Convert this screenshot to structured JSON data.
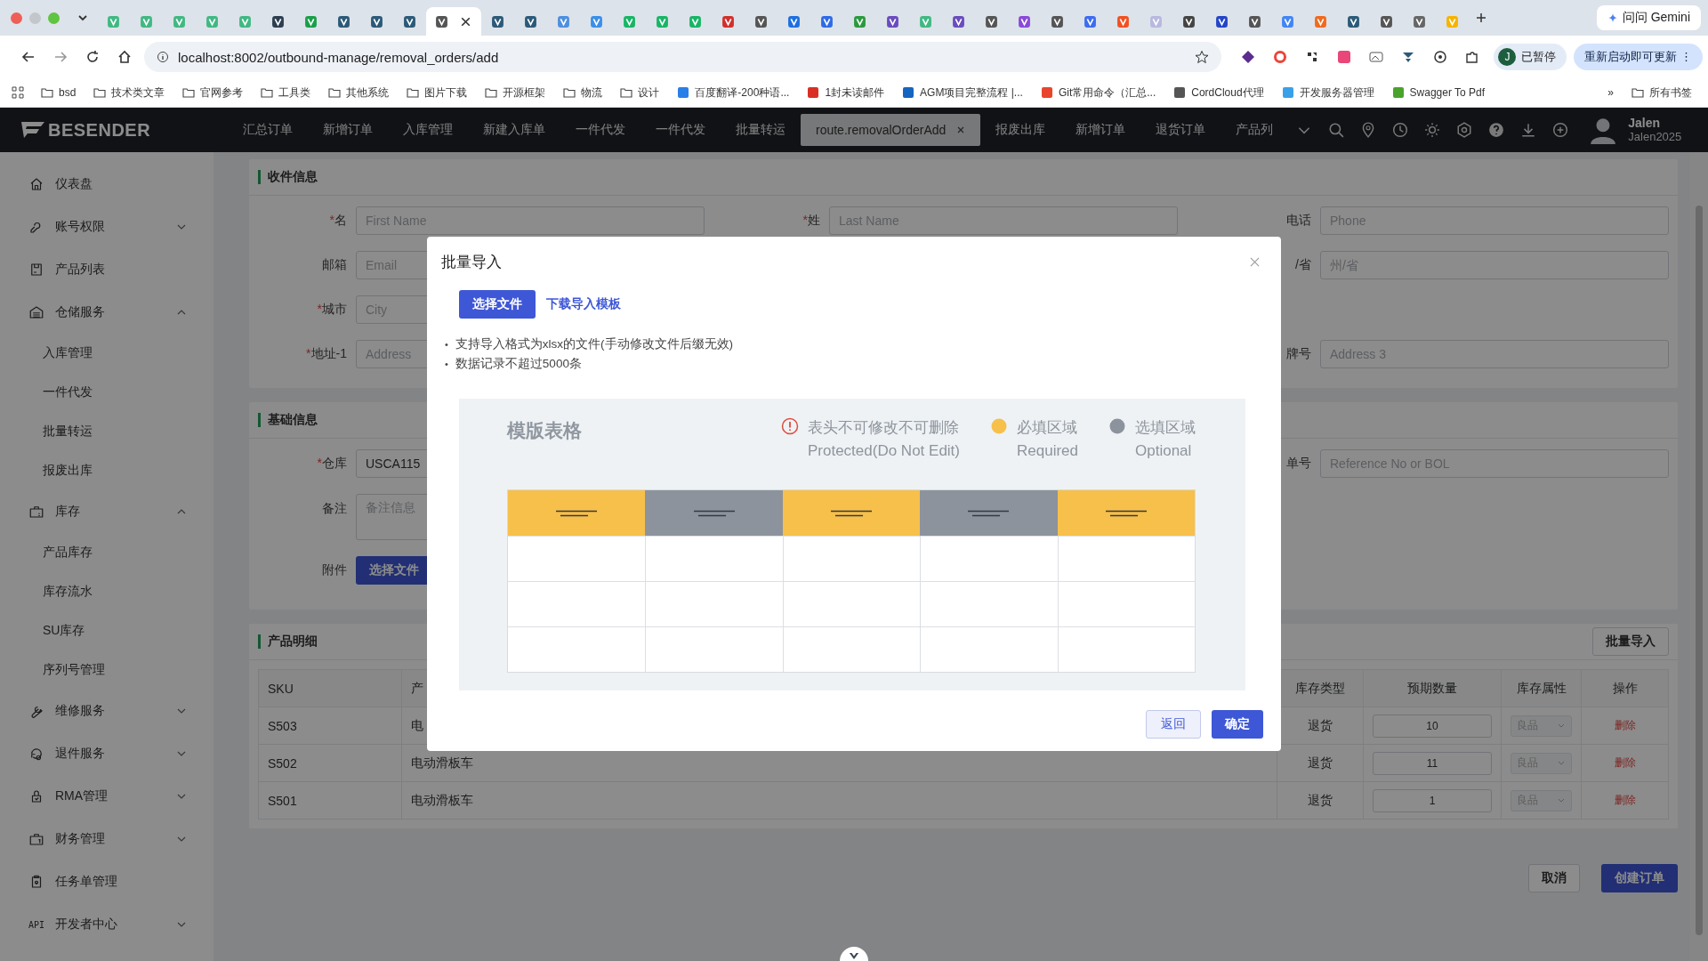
{
  "browser": {
    "tabs": [
      {
        "selected": false,
        "color": "#41b883"
      },
      {
        "selected": false,
        "color": "#41b883"
      },
      {
        "selected": false,
        "color": "#41b883"
      },
      {
        "selected": false,
        "color": "#41b883"
      },
      {
        "selected": false,
        "color": "#41b883"
      },
      {
        "selected": false,
        "color": "#2c3e50"
      },
      {
        "selected": false,
        "color": "#1a9f4a"
      },
      {
        "selected": false,
        "color": "#2c5a78"
      },
      {
        "selected": false,
        "color": "#2c5a78"
      },
      {
        "selected": false,
        "color": "#2c5a78"
      },
      {
        "selected": true,
        "color": "#555555"
      },
      {
        "selected": false,
        "color": "#2c5a78"
      },
      {
        "selected": false,
        "color": "#2c5a78"
      },
      {
        "selected": false,
        "color": "#4d8fe0"
      },
      {
        "selected": false,
        "color": "#3b8fe8"
      },
      {
        "selected": false,
        "color": "#18b566"
      },
      {
        "selected": false,
        "color": "#18b566"
      },
      {
        "selected": false,
        "color": "#18b566"
      },
      {
        "selected": false,
        "color": "#d0312d"
      },
      {
        "selected": false,
        "color": "#555555"
      },
      {
        "selected": false,
        "color": "#1d6fe0"
      },
      {
        "selected": false,
        "color": "#2f6be6"
      },
      {
        "selected": false,
        "color": "#2b9a3e"
      },
      {
        "selected": false,
        "color": "#6a4cbf"
      },
      {
        "selected": false,
        "color": "#41b883"
      },
      {
        "selected": false,
        "color": "#6a4cbf"
      },
      {
        "selected": false,
        "color": "#555555"
      },
      {
        "selected": false,
        "color": "#8a4ad8"
      },
      {
        "selected": false,
        "color": "#555555"
      },
      {
        "selected": false,
        "color": "#3d6cf0"
      },
      {
        "selected": false,
        "color": "#f25022"
      },
      {
        "selected": false,
        "color": "#b8b8e0"
      },
      {
        "selected": false,
        "color": "#444444"
      },
      {
        "selected": false,
        "color": "#2345c8"
      },
      {
        "selected": false,
        "color": "#555555"
      },
      {
        "selected": false,
        "color": "#4285f4"
      },
      {
        "selected": false,
        "color": "#f06a1d"
      },
      {
        "selected": false,
        "color": "#2c5a78"
      },
      {
        "selected": false,
        "color": "#555555"
      },
      {
        "selected": false,
        "color": "#666666"
      },
      {
        "selected": false,
        "color": "#f5b400"
      }
    ],
    "gemini": "问问 Gemini",
    "url": "localhost:8002/outbound-manage/removal_orders/add",
    "profile_initial": "J",
    "profile_status": "已暂停",
    "update_button": "重新启动即可更新",
    "update_menu": "⋮",
    "bookmarks": [
      {
        "kind": "folder",
        "label": "bsd"
      },
      {
        "kind": "folder",
        "label": "技术类文章"
      },
      {
        "kind": "folder",
        "label": "官网参考"
      },
      {
        "kind": "folder",
        "label": "工具类"
      },
      {
        "kind": "folder",
        "label": "其他系统"
      },
      {
        "kind": "folder",
        "label": "图片下载"
      },
      {
        "kind": "folder",
        "label": "开源框架"
      },
      {
        "kind": "folder",
        "label": "物流"
      },
      {
        "kind": "folder",
        "label": "设计"
      },
      {
        "kind": "site",
        "label": "百度翻译-200种语...",
        "color": "#2a7ee8"
      },
      {
        "kind": "site",
        "label": "1封未读邮件",
        "color": "#d93025"
      },
      {
        "kind": "site",
        "label": "AGM项目完整流程 |...",
        "color": "#1565c0"
      },
      {
        "kind": "site",
        "label": "Git常用命令（汇总...",
        "color": "#e8452c"
      },
      {
        "kind": "site",
        "label": "CordCloud代理",
        "color": "#555555"
      },
      {
        "kind": "site",
        "label": "开发服务器管理",
        "color": "#3aa0e8"
      },
      {
        "kind": "site",
        "label": "Swagger To Pdf",
        "color": "#49a32b"
      }
    ],
    "more": "»",
    "all_bookmarks": "所有书签"
  },
  "app": {
    "logo": "BESENDER",
    "nav": [
      {
        "label": "汇总订单",
        "selected": false
      },
      {
        "label": "新增订单",
        "selected": false
      },
      {
        "label": "入库管理",
        "selected": false
      },
      {
        "label": "新建入库单",
        "selected": false
      },
      {
        "label": "一件代发",
        "selected": false
      },
      {
        "label": "一件代发",
        "selected": false
      },
      {
        "label": "批量转运",
        "selected": false
      },
      {
        "label": "route.removalOrderAdd",
        "selected": true
      },
      {
        "label": "报废出库",
        "selected": false
      },
      {
        "label": "新增订单",
        "selected": false
      },
      {
        "label": "退货订单",
        "selected": false
      },
      {
        "label": "产品列",
        "selected": false
      }
    ],
    "user": {
      "name": "Jalen",
      "account": "Jalen2025"
    }
  },
  "sidebar": [
    {
      "kind": "link",
      "label": "仪表盘"
    },
    {
      "kind": "group",
      "label": "账号权限",
      "expanded": false
    },
    {
      "kind": "link",
      "label": "产品列表"
    },
    {
      "kind": "group",
      "label": "仓储服务",
      "expanded": true,
      "children": [
        {
          "label": "入库管理"
        },
        {
          "label": "一件代发"
        },
        {
          "label": "批量转运"
        },
        {
          "label": "报废出库"
        }
      ]
    },
    {
      "kind": "group",
      "label": "库存",
      "expanded": true,
      "children": [
        {
          "label": "产品库存"
        },
        {
          "label": "库存流水"
        },
        {
          "label": "SU库存"
        },
        {
          "label": "序列号管理"
        }
      ]
    },
    {
      "kind": "group",
      "label": "维修服务",
      "expanded": false
    },
    {
      "kind": "group",
      "label": "退件服务",
      "expanded": false
    },
    {
      "kind": "group",
      "label": "RMA管理",
      "expanded": false
    },
    {
      "kind": "group",
      "label": "财务管理",
      "expanded": false
    },
    {
      "kind": "link",
      "label": "任务单管理"
    },
    {
      "kind": "group",
      "label": "开发者中心",
      "expanded": false,
      "icon_text": "API"
    }
  ],
  "required_mark": "*",
  "recipient": {
    "title": "收件信息",
    "rows": [
      [
        {
          "label": "名",
          "required": true,
          "placeholder": "First Name"
        },
        {
          "label": "姓",
          "required": true,
          "placeholder": "Last Name"
        },
        {
          "label": "电话",
          "required": false,
          "placeholder": "Phone"
        }
      ],
      [
        {
          "label": "邮箱",
          "required": false,
          "placeholder": "Email"
        },
        null,
        {
          "label": "/省",
          "placeholder": "州/省"
        }
      ],
      [
        {
          "label": "城市",
          "required": true,
          "placeholder": "City"
        },
        null,
        null
      ],
      [
        {
          "label": "地址-1",
          "required": true,
          "placeholder": "Address"
        },
        null,
        {
          "label": "牌号",
          "placeholder": "Address 3"
        }
      ]
    ]
  },
  "basic": {
    "title": "基础信息",
    "warehouse": {
      "label": "仓库",
      "required": true,
      "value": "USCA115"
    },
    "reference": {
      "label": "单号",
      "placeholder": "Reference No or BOL"
    },
    "remark": {
      "label": "备注",
      "placeholder": "备注信息"
    },
    "attachment": {
      "label": "附件",
      "button": "选择文件"
    }
  },
  "products": {
    "title": "产品明细",
    "import_button": "批量导入",
    "columns": [
      "SKU",
      "产",
      "库存类型",
      "预期数量",
      "库存属性",
      "操作"
    ],
    "rows": [
      {
        "sku": "S503",
        "name": "电",
        "type": "退货",
        "qty": "10",
        "attr": "良品",
        "action": "删除"
      },
      {
        "sku": "S502",
        "name": "电动滑板车",
        "type": "退货",
        "qty": "11",
        "attr": "良品",
        "action": "删除"
      },
      {
        "sku": "S501",
        "name": "电动滑板车",
        "type": "退货",
        "qty": "1",
        "attr": "良品",
        "action": "删除"
      }
    ]
  },
  "footer": {
    "cancel": "取消",
    "submit": "创建订单"
  },
  "dialog": {
    "title": "批量导入",
    "choose_file": "选择文件",
    "download_template": "下载导入模板",
    "note_marker": "•",
    "notes": [
      "支持导入格式为xlsx的文件(手动修改文件后缀无效)",
      "数据记录不超过5000条"
    ],
    "template": {
      "title": "模版表格",
      "legend": [
        {
          "kind": "warning",
          "label": "表头不可修改不可删除",
          "sub": "Protected(Do Not Edit)",
          "color": "#e0493e"
        },
        {
          "kind": "required",
          "label": "必填区域",
          "sub": "Required",
          "color": "#f7c04a"
        },
        {
          "kind": "optional",
          "label": "选填区域",
          "sub": "Optional",
          "color": "#8c939d"
        }
      ],
      "columns": [
        {
          "kind": "required"
        },
        {
          "kind": "optional"
        },
        {
          "kind": "required"
        },
        {
          "kind": "optional"
        },
        {
          "kind": "required"
        }
      ]
    },
    "back": "返回",
    "confirm": "确定"
  }
}
